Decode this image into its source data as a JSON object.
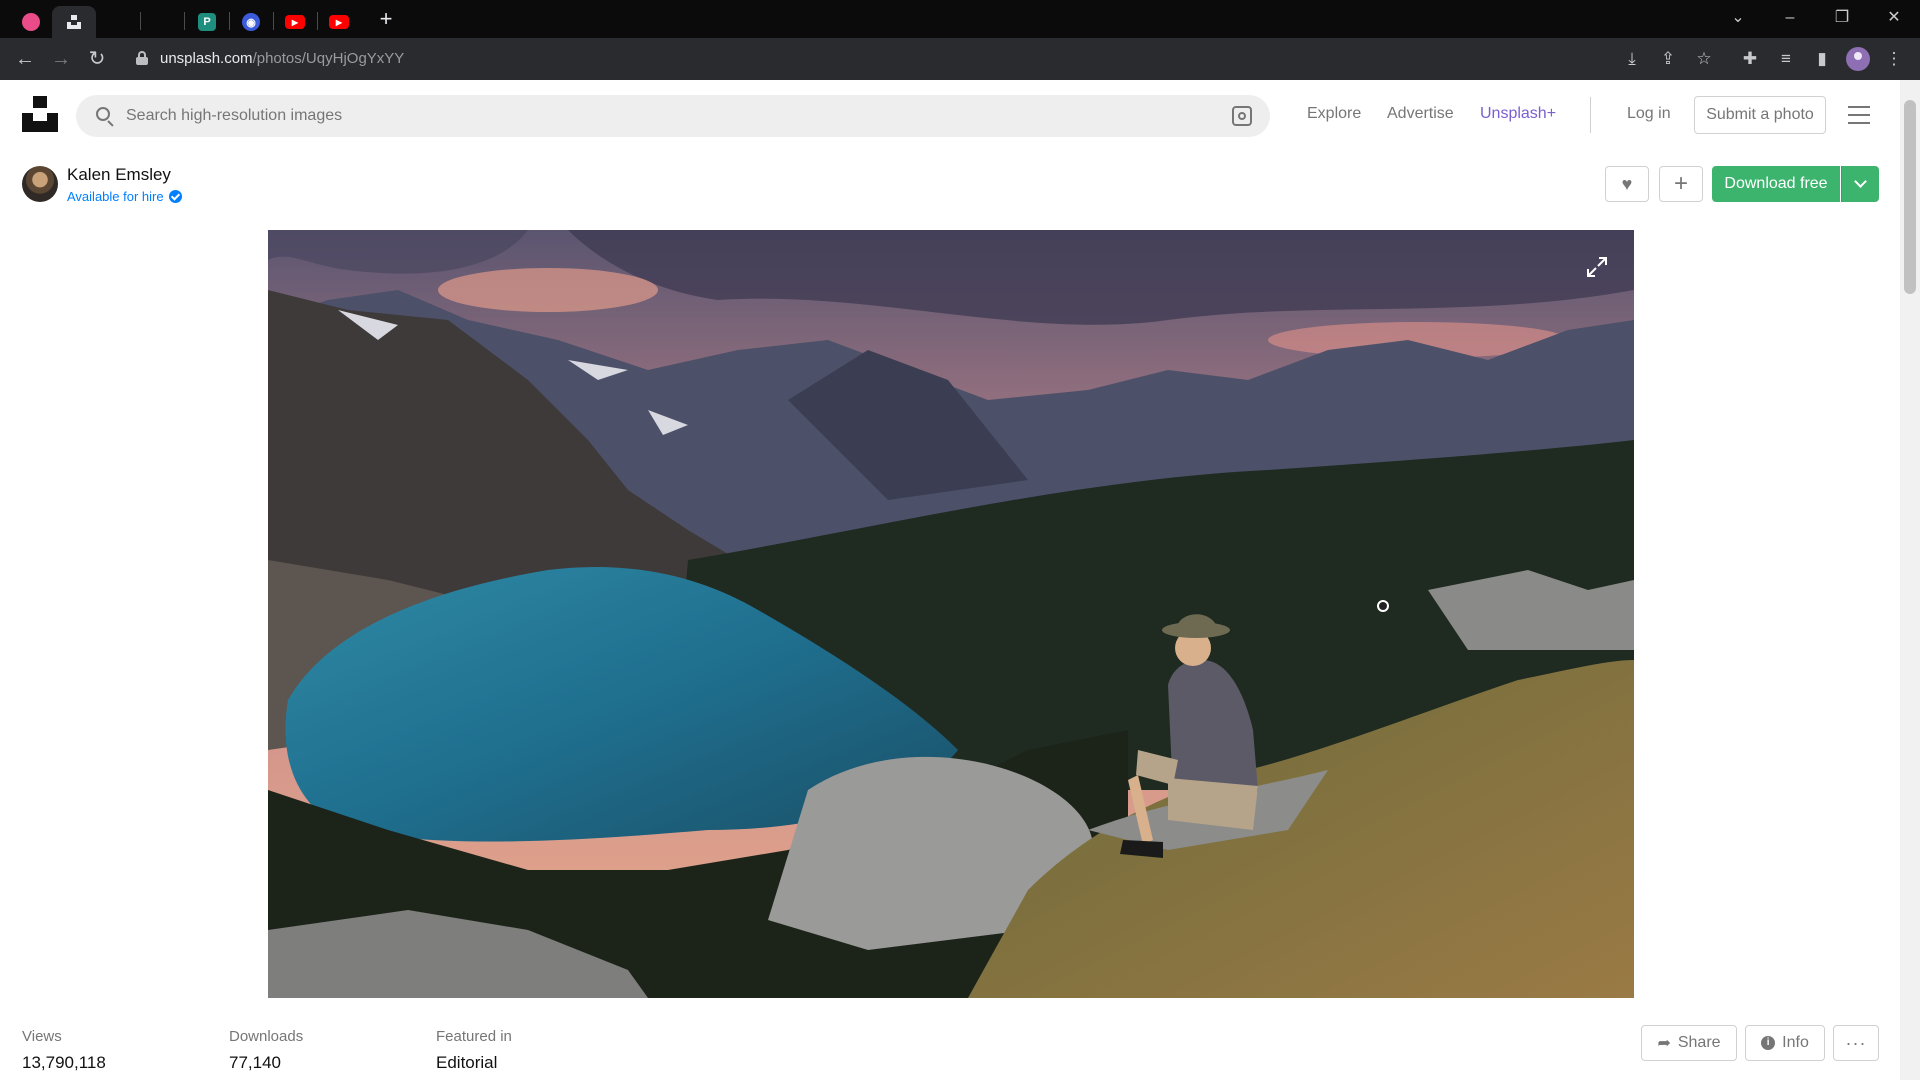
{
  "browser": {
    "tabs": [
      {
        "icon": "dribbble-icon",
        "color": "#ea4c89",
        "active": false
      },
      {
        "icon": "unsplash-icon",
        "color": "#111111",
        "active": true
      },
      {
        "icon": "blank-tab-icon",
        "color": "#0b0b0c",
        "active": false
      },
      {
        "icon": "blank-tab-icon",
        "color": "#0b0b0c",
        "active": false
      },
      {
        "icon": "p-app-icon",
        "color": "#1e8f7e",
        "active": false
      },
      {
        "icon": "bot-icon",
        "color": "#3b5bdb",
        "active": false
      },
      {
        "icon": "youtube-icon",
        "color": "#ff0000",
        "active": false
      },
      {
        "icon": "youtube-icon",
        "color": "#ff0000",
        "active": false
      }
    ],
    "url_host": "unsplash.com",
    "url_path": "/photos/UqyHjOgYxYY"
  },
  "header": {
    "search_placeholder": "Search high-resolution images",
    "nav": {
      "explore": "Explore",
      "advertise": "Advertise",
      "unsplash_plus": "Unsplash+",
      "login": "Log in",
      "submit": "Submit a photo"
    }
  },
  "author": {
    "name": "Kalen Emsley",
    "availability": "Available for hire"
  },
  "actions": {
    "download": "Download free",
    "share": "Share",
    "info": "Info"
  },
  "stats": [
    {
      "label": "Views",
      "value": "13,790,118"
    },
    {
      "label": "Downloads",
      "value": "77,140"
    },
    {
      "label": "Featured in",
      "value": "Editorial"
    }
  ],
  "colors": {
    "accent_green": "#3cb46e",
    "plus_purple": "#7b5fd0",
    "link_blue": "#007fff"
  }
}
